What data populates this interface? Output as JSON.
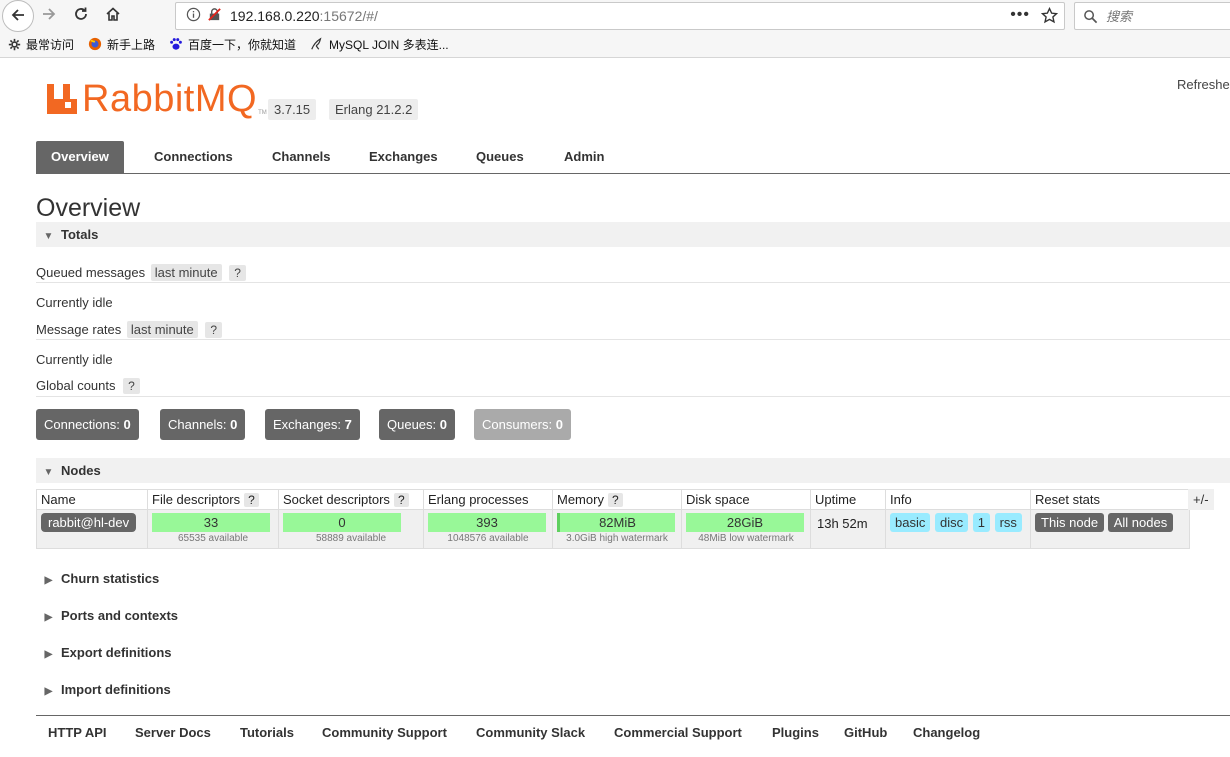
{
  "browser": {
    "url_host": "192.168.0.220",
    "url_rest": ":15672/#/",
    "search_placeholder": "搜索",
    "bookmarks": [
      {
        "label": "最常访问",
        "icon": "gear-icon"
      },
      {
        "label": "新手上路",
        "icon": "firefox-icon"
      },
      {
        "label": "百度一下，你就知道",
        "icon": "baidu-paw-icon"
      },
      {
        "label": "MySQL JOIN 多表连...",
        "icon": "mysql-dolphin-icon"
      }
    ]
  },
  "header": {
    "logo_text": "RabbitMQ",
    "logo_tm": "TM",
    "version": "3.7.15",
    "erlang": "Erlang 21.2.2",
    "refreshed": "Refreshe"
  },
  "tabs": [
    {
      "label": "Overview",
      "active": true
    },
    {
      "label": "Connections"
    },
    {
      "label": "Channels"
    },
    {
      "label": "Exchanges"
    },
    {
      "label": "Queues"
    },
    {
      "label": "Admin"
    }
  ],
  "page_title": "Overview",
  "totals": {
    "header": "Totals",
    "queued_label": "Queued messages",
    "queued_range": "last minute",
    "qmark": "?",
    "idle1": "Currently idle",
    "rates_label": "Message rates",
    "rates_range": "last minute",
    "idle2": "Currently idle",
    "global_label": "Global counts",
    "counts": [
      {
        "label": "Connections:",
        "value": "0"
      },
      {
        "label": "Channels:",
        "value": "0"
      },
      {
        "label": "Exchanges:",
        "value": "7"
      },
      {
        "label": "Queues:",
        "value": "0"
      },
      {
        "label": "Consumers:",
        "value": "0"
      }
    ]
  },
  "nodes": {
    "header": "Nodes",
    "columns": [
      "Name",
      "File descriptors",
      "Socket descriptors",
      "Erlang processes",
      "Memory",
      "Disk space",
      "Uptime",
      "Info",
      "Reset stats"
    ],
    "plus_minus": "+/-",
    "row": {
      "name": "rabbit@hl-dev",
      "file_desc": "33",
      "file_desc_fill": 0.0005,
      "file_desc_sub": "65535 available",
      "socket_desc": "0",
      "socket_desc_fill": 0.0,
      "socket_desc_sub": "58889 available",
      "erlang_proc": "393",
      "erlang_proc_fill": 0.0004,
      "erlang_proc_sub": "1048576 available",
      "memory": "82MiB",
      "memory_fill": 0.03,
      "memory_sub": "3.0GiB high watermark",
      "disk": "28GiB",
      "disk_sub": "48MiB low watermark",
      "uptime": "13h 52m",
      "info": [
        "basic",
        "disc",
        "1",
        "rss"
      ],
      "reset": [
        "This node",
        "All nodes"
      ]
    }
  },
  "collapsed_sections": [
    "Churn statistics",
    "Ports and contexts",
    "Export definitions",
    "Import definitions"
  ],
  "footer": [
    "HTTP API",
    "Server Docs",
    "Tutorials",
    "Community Support",
    "Community Slack",
    "Commercial Support",
    "Plugins",
    "GitHub",
    "Changelog"
  ],
  "colors": {
    "brand_orange": "#f26822",
    "ok_green": "#98f898",
    "info_blue": "#99ebff",
    "tab_gray": "#666666"
  }
}
